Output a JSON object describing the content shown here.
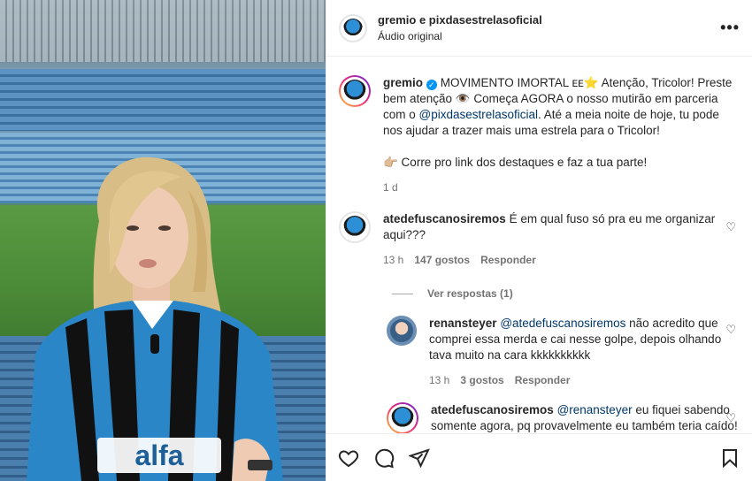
{
  "header": {
    "title": "gremio e pixdasestrelasoficial",
    "subtitle": "Áudio original",
    "more_label": "•••"
  },
  "post": {
    "username": "gremio",
    "verified_glyph": "✓",
    "text_1": "MOVIMENTO IMORTAL ᴇᴇ⭐ Atenção, Tricolor! Preste bem atenção 👁️ Começa AGORA o nosso mutirão em parceria com o ",
    "mention": "@pixdasestrelasoficial",
    "text_2": ". Até a meia noite de hoje, tu pode nos ajudar a trazer mais uma estrela para o Tricolor!",
    "text_3": "👉🏼 Corre pro link dos destaques e faz a tua parte!",
    "time": "1 d"
  },
  "comments": [
    {
      "username": "atedefuscanosiremos",
      "text": "É em qual fuso só pra eu me organizar aqui???",
      "time": "13 h",
      "likes": "147 gostos",
      "reply": "Responder",
      "view_replies": "Ver respostas (1)"
    }
  ],
  "replies": [
    {
      "username": "renansteyer",
      "mention": "@atedefuscanosiremos",
      "text": "não acredito que comprei essa merda e cai nesse golpe, depois olhando tava muito na cara kkkkkkkkkk",
      "time": "13 h",
      "likes": "3 gostos",
      "reply": "Responder"
    },
    {
      "username": "atedefuscanosiremos",
      "mention": "@renansteyer",
      "text": "eu fiquei sabendo somente agora, pq provavelmente eu também teria caído! Hahahahaha"
    }
  ],
  "icons": {
    "like": "heart-icon",
    "comment": "comment-icon",
    "share": "share-icon",
    "save": "bookmark-icon"
  },
  "colors": {
    "mention": "#00376b",
    "verified": "#0095f6",
    "muted": "#737373"
  }
}
